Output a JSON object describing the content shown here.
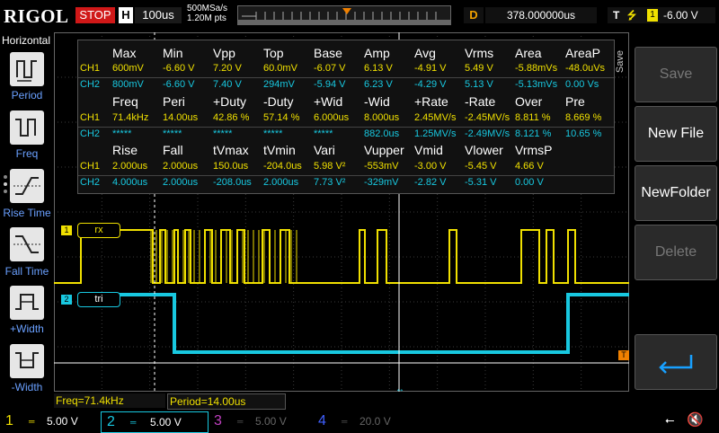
{
  "top": {
    "logo": "RIGOL",
    "run_state": "STOP",
    "timebase_label": "H",
    "timebase_value": "100us",
    "sample_rate": "500MSa/s",
    "memory_points": "1.20M pts",
    "delay_label": "D",
    "delay_value": "378.000000us",
    "trigger_label": "T",
    "trigger_channel": "1",
    "trigger_level": "-6.00 V"
  },
  "left_menu": {
    "title": "Horizontal",
    "items": [
      "Period",
      "Freq",
      "Rise Time",
      "Fall Time",
      "+Width",
      "-Width"
    ]
  },
  "right_menu": {
    "side_label": "Save",
    "items": [
      "Save",
      "New File",
      "NewFolder",
      "Delete"
    ]
  },
  "measure_table": {
    "block1": {
      "headers": [
        "Max",
        "Min",
        "Vpp",
        "Top",
        "Base",
        "Amp",
        "Avg",
        "Vrms",
        "Area",
        "AreaP"
      ],
      "ch1": [
        "CH1",
        "600mV",
        "-6.60 V",
        "7.20 V",
        "60.0mV",
        "-6.07 V",
        "6.13 V",
        "-4.91 V",
        "5.49 V",
        "-5.88mVs",
        "-48.0uVs"
      ],
      "ch2": [
        "CH2",
        "800mV",
        "-6.60 V",
        "7.40 V",
        "294mV",
        "-5.94 V",
        "6.23 V",
        "-4.29 V",
        "5.13 V",
        "-5.13mVs",
        "0.00 Vs"
      ]
    },
    "block2": {
      "headers": [
        "Freq",
        "Peri",
        "+Duty",
        "-Duty",
        "+Wid",
        "-Wid",
        "+Rate",
        "-Rate",
        "Over",
        "Pre"
      ],
      "ch1": [
        "CH1",
        "71.4kHz",
        "14.00us",
        "42.86 %",
        "57.14 %",
        "6.000us",
        "8.000us",
        "2.45MV/s",
        "-2.45MV/s",
        "8.811 %",
        "8.669 %"
      ],
      "ch2": [
        "CH2",
        "*****",
        "*****",
        "*****",
        "*****",
        "*****",
        "882.0us",
        "1.25MV/s",
        "-2.49MV/s",
        "8.121 %",
        "10.65 %"
      ]
    },
    "block3": {
      "headers": [
        "Rise",
        "Fall",
        "tVmax",
        "tVmin",
        "Vari",
        "Vupper",
        "Vmid",
        "Vlower",
        "VrmsP"
      ],
      "ch1": [
        "CH1",
        "2.000us",
        "2.000us",
        "150.0us",
        "-204.0us",
        "5.98 V²",
        "-553mV",
        "-3.00 V",
        "-5.45 V",
        "4.66 V"
      ],
      "ch2": [
        "CH2",
        "4.000us",
        "2.000us",
        "-208.0us",
        "2.000us",
        "7.73 V²",
        "-329mV",
        "-2.82 V",
        "-5.31 V",
        "0.00 V"
      ]
    }
  },
  "channels": {
    "ch1_marker": "1",
    "ch1_label": "rx",
    "ch2_marker": "2",
    "ch2_label": "tri",
    "trigger_marker": "T"
  },
  "readouts": {
    "freq": "Freq=71.4kHz",
    "period": "Period=14.00us"
  },
  "bottom": {
    "ch1_num": "1",
    "ch1_scale": "5.00 V",
    "ch2_num": "2",
    "ch2_scale": "5.00 V",
    "ch3_num": "3",
    "ch3_scale": "5.00 V",
    "ch4_num": "4",
    "ch4_scale": "20.0 V"
  },
  "colors": {
    "ch1": "#f0e000",
    "ch2": "#18c8e0",
    "ch3": "#c040c0",
    "ch4": "#4060ff",
    "trigger": "#f08000",
    "stop": "#d01818"
  }
}
